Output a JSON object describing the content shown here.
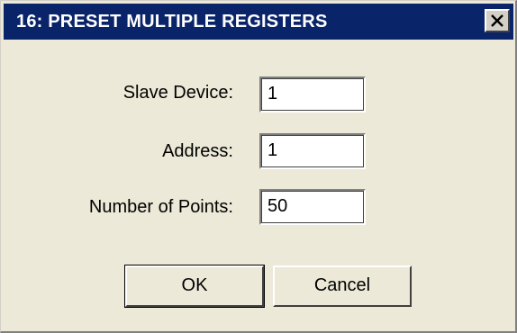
{
  "window": {
    "title": "16: PRESET MULTIPLE REGISTERS",
    "close_icon": "close-icon"
  },
  "colors": {
    "titlebar": "#0a246a",
    "dialog_background": "#ece9d8",
    "title_text": "#ffffff"
  },
  "fields": [
    {
      "label": "Slave Device:",
      "value": "1"
    },
    {
      "label": "Address:",
      "value": "1"
    },
    {
      "label": "Number of Points:",
      "value": "50"
    }
  ],
  "buttons": {
    "ok_label": "OK",
    "cancel_label": "Cancel"
  }
}
